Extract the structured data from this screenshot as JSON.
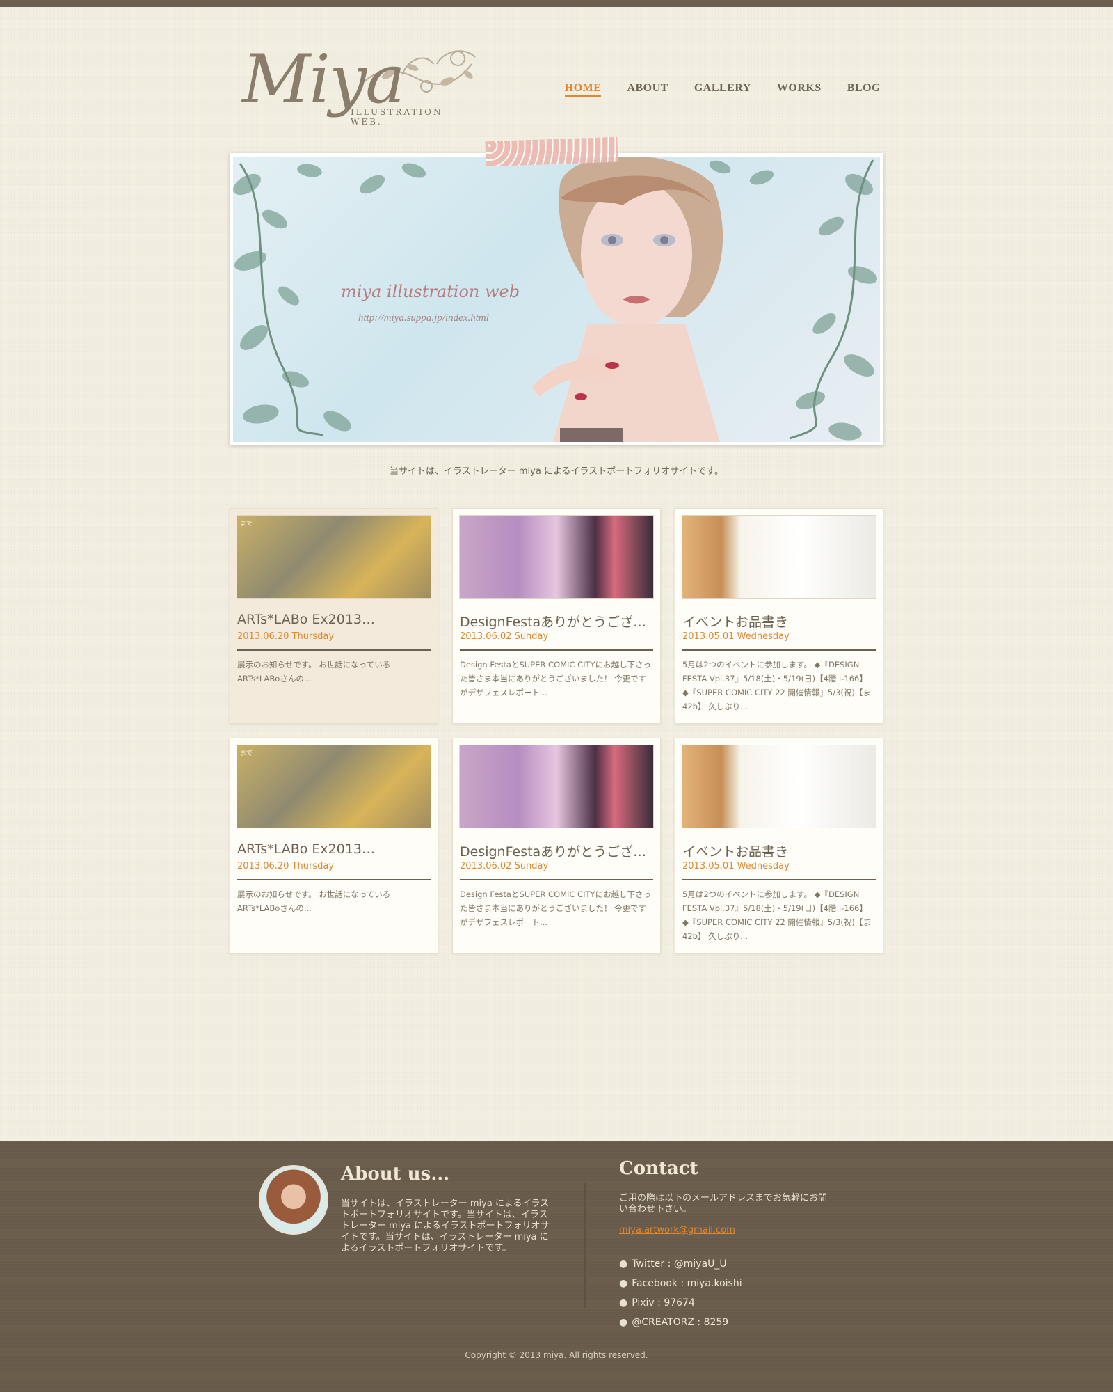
{
  "brand": {
    "logo_text": "Miya",
    "logo_sub": "ILLUSTRATION WEB."
  },
  "nav": {
    "items": [
      {
        "label": "HOME",
        "active": true
      },
      {
        "label": "ABOUT"
      },
      {
        "label": "GALLERY"
      },
      {
        "label": "WORKS"
      },
      {
        "label": "BLOG"
      }
    ]
  },
  "hero": {
    "title": "miya illustration web",
    "url": "http://miya.suppa.jp/index.html"
  },
  "tagline": "当サイトは、イラストレーター miya によるイラストポートフォリオサイトです。",
  "cards": [
    {
      "title": "ARTs*LABo Ex2013…",
      "date": "2013.06.20 Thursday",
      "body": "展示のお知らせです。 お世話になっている ARTs*LABoさんの...",
      "tag": "まで",
      "thumb": "art"
    },
    {
      "title": "DesignFestaありがとうござ…",
      "date": "2013.06.02 Sunday",
      "body": "Design FestaとSUPER COMIC CITYにお越し下さった皆さま本当にありがとうございました！ 今更ですがデザフェスレポート...",
      "tag": "",
      "thumb": "booth"
    },
    {
      "title": "イベントお品書き",
      "date": "2013.05.01 Wednesday",
      "body": "5月は2つのイベントに参加します。 ◆『DESIGN FESTA Vpl.37』5/18(土)・5/19(日)【4階 i-166】 ◆『SUPER COMIC CITY 22 開催情報』5/3(祝)【ま42b】 久しぶり...",
      "tag": "",
      "thumb": "book"
    },
    {
      "title": "ARTs*LABo Ex2013…",
      "date": "2013.06.20 Thursday",
      "body": "展示のお知らせです。 お世話になっている ARTs*LABoさんの...",
      "tag": "まで",
      "thumb": "art"
    },
    {
      "title": "DesignFestaありがとうござ…",
      "date": "2013.06.02 Sunday",
      "body": "Design FestaとSUPER COMIC CITYにお越し下さった皆さま本当にありがとうございました！ 今更ですがデザフェスレポート...",
      "tag": "",
      "thumb": "booth"
    },
    {
      "title": "イベントお品書き",
      "date": "2013.05.01 Wednesday",
      "body": "5月は2つのイベントに参加します。 ◆『DESIGN FESTA Vpl.37』5/18(土)・5/19(日)【4階 i-166】 ◆『SUPER COMIC CITY 22 開催情報』5/3(祝)【ま42b】 久しぶり...",
      "tag": "",
      "thumb": "book"
    }
  ],
  "footer": {
    "about_heading": "About us...",
    "about_text": "当サイトは、イラストレーター miya によるイラストポートフォリオサイトです。当サイトは、イラストレーター miya によるイラストポートフォリオサイトです。当サイトは、イラストレーター miya によるイラストポートフォリオサイトです。",
    "contact_heading": "Contact",
    "contact_text": "ご用の際は以下のメールアドレスまでお気軽にお問い合わせ下さい。",
    "email": "miya.artwork@gmail.com",
    "links": [
      "Twitter : @miyaU_U",
      "Facebook : miya.koishi",
      "Pixiv : 97674",
      "@CREATORZ : 8259"
    ],
    "copyright": "Copyright © 2013 miya. All rights reserved."
  },
  "colors": {
    "accent": "#e0882e",
    "footer_bg": "#6b5e4d",
    "page_bg": "#f3efe3",
    "card_highlight": "#f4eadb"
  }
}
